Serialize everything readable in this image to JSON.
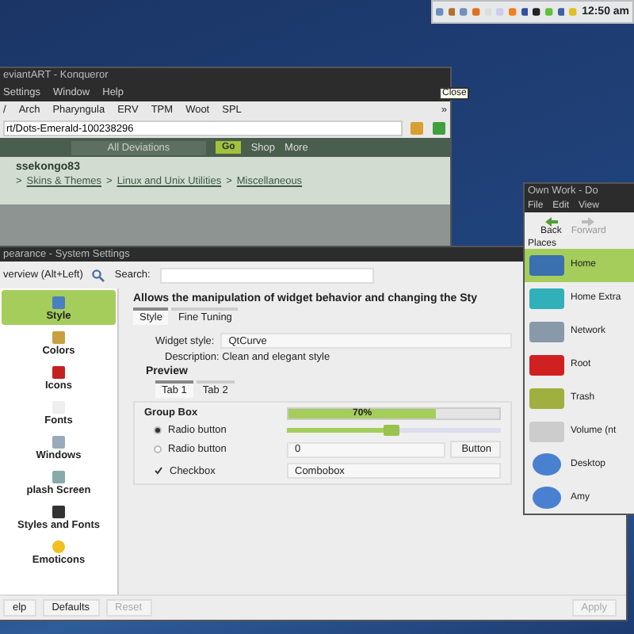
{
  "panel": {
    "clock": "12:50 am"
  },
  "konqueror": {
    "title": "eviantART - Konqueror",
    "menu": [
      "Settings",
      "Window",
      "Help"
    ],
    "bookmarks": [
      "/",
      "Arch",
      "Pharyngula",
      "ERV",
      "TPM",
      "Woot",
      "SPL"
    ],
    "more": "»",
    "url": "rt/Dots-Emerald-100238296",
    "site": {
      "scope": "All Deviations",
      "go": "Go",
      "links": [
        "Shop",
        "More"
      ],
      "user": "ssekongo83",
      "separator": ">",
      "breadcrumb": [
        "Skins & Themes",
        "Linux and Unix Utilities",
        "Miscellaneous"
      ]
    }
  },
  "tooltip": "Close",
  "settings": {
    "title": "pearance - System Settings",
    "back": "verview (Alt+Left)",
    "search_label": "Search:",
    "sidebar": [
      {
        "label": "Style",
        "selected": true
      },
      {
        "label": "Colors",
        "selected": false
      },
      {
        "label": "Icons",
        "selected": false
      },
      {
        "label": "Fonts",
        "selected": false
      },
      {
        "label": "Windows",
        "selected": false
      },
      {
        "label": "plash Screen",
        "selected": false
      },
      {
        "label": "Styles and Fonts",
        "selected": false
      },
      {
        "label": "Emoticons",
        "selected": false
      }
    ],
    "heading": "Allows the manipulation of widget behavior and changing the Sty",
    "tabs": [
      {
        "label": "Style",
        "selected": true
      },
      {
        "label": "Fine Tuning",
        "selected": false
      }
    ],
    "widget_style_label": "Widget style:",
    "widget_style": "QtCurve",
    "description": "Description: Clean and elegant style",
    "preview_label": "Preview",
    "preview_tabs": [
      {
        "label": "Tab 1",
        "selected": true
      },
      {
        "label": "Tab 2",
        "selected": false
      }
    ],
    "group_box": {
      "title": "Group Box",
      "radios": [
        {
          "label": "Radio button",
          "selected": true
        },
        {
          "label": "Radio button",
          "selected": false
        }
      ],
      "checkbox": {
        "label": "Checkbox",
        "checked": true
      },
      "progress": {
        "level": 0.7,
        "text": "70%"
      },
      "slider": {
        "level": 0.49
      },
      "spin": "0",
      "button": "Button",
      "combo": "Combobox"
    },
    "buttons": [
      {
        "label": "elp",
        "disabled": false
      },
      {
        "label": "Defaults",
        "disabled": false
      },
      {
        "label": "Reset",
        "disabled": true
      }
    ],
    "apply": {
      "label": "Apply",
      "disabled": true
    }
  },
  "dolphin": {
    "title": "Own Work - Do",
    "menu": [
      "File",
      "Edit",
      "View"
    ],
    "nav": [
      {
        "label": "Back",
        "disabled": false
      },
      {
        "label": "Forward",
        "disabled": true
      }
    ],
    "places_label": "Places",
    "places": [
      {
        "label": "Home",
        "selected": true
      },
      {
        "label": "Home Extra",
        "selected": false
      },
      {
        "label": "Network",
        "selected": false
      },
      {
        "label": "Root",
        "selected": false
      },
      {
        "label": "Trash",
        "selected": false
      },
      {
        "label": "Volume (nt",
        "selected": false
      },
      {
        "label": "Desktop",
        "selected": false
      },
      {
        "label": "Amy",
        "selected": false
      }
    ]
  }
}
